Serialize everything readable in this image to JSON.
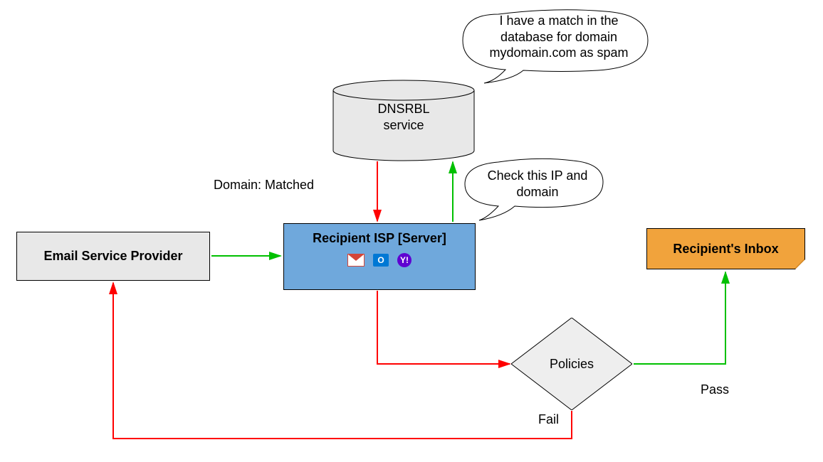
{
  "nodes": {
    "esp": "Email Service Provider",
    "isp": "Recipient ISP [Server]",
    "dnsrbl_line1": "DNSRBL",
    "dnsrbl_line2": "service",
    "policies": "Policies",
    "inbox": "Recipient's Inbox"
  },
  "speech": {
    "match": "I have a match in the database for domain mydomain.com as spam",
    "check": "Check this IP and domain"
  },
  "labels": {
    "domain_matched": "Domain: Matched",
    "fail": "Fail",
    "pass": "Pass"
  },
  "icons": {
    "gmail": "gmail-icon",
    "outlook": "outlook-icon",
    "yahoo": "yahoo-icon",
    "outlook_glyph": "O",
    "yahoo_glyph": "Y!"
  },
  "colors": {
    "green": "#00c000",
    "red": "#ff0000",
    "isp_bg": "#6fa8dc",
    "inbox_bg": "#f1a33c",
    "box_bg": "#e8e8e8"
  }
}
